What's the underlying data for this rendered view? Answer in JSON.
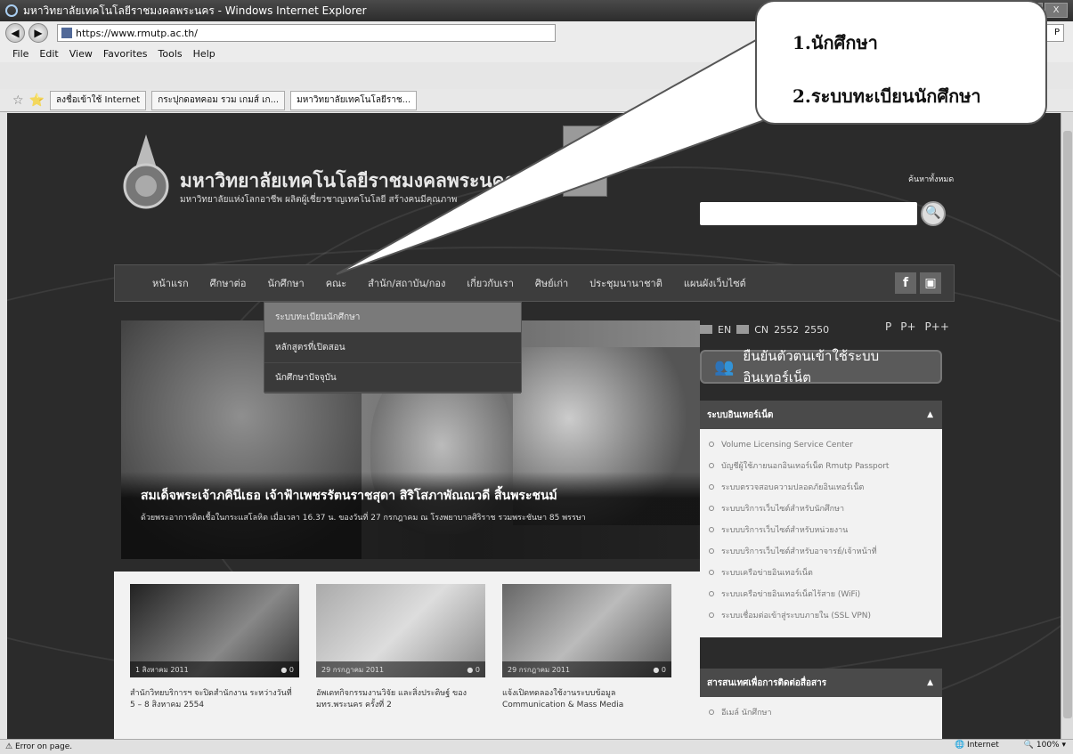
{
  "window": {
    "title": "มหาวิทยาลัยเทคโนโลยีราชมงคลพระนคร - Windows Internet Explorer",
    "buttons": [
      "_",
      "□",
      "X"
    ]
  },
  "address": {
    "back": "◀",
    "forward": "▶",
    "url": "https://www.rmutp.ac.th/",
    "search_placeholder": "P"
  },
  "menu": [
    "File",
    "Edit",
    "View",
    "Favorites",
    "Tools",
    "Help"
  ],
  "tabs": [
    {
      "label": "ลงชื่อเข้าใช้ Internet"
    },
    {
      "label": "กระปุกดอทคอม รวม เกมส์ เก..."
    },
    {
      "label": "มหาวิทยาลัยเทคโนโลยีราช..."
    }
  ],
  "callout": {
    "line1": "1.นักศึกษา",
    "line2": "2.ระบบทะเบียนนักศึกษา"
  },
  "site": {
    "name": "มหาวิทยาลัยเทคโนโลยีราชมงคลพระนคร",
    "slogan": "มหาวิทยาลัยแห่งโลกอาชีพ ผลิตผู้เชี่ยวชาญเทคโนโลยี สร้างคนมีคุณภาพ",
    "badge": "6",
    "search_all": "ค้นหาทั้งหมด",
    "search_btn": "🔍"
  },
  "nav": [
    "หน้าแรก",
    "ศึกษาต่อ",
    "นักศึกษา",
    "คณะ",
    "สำนัก/สถาบัน/กอง",
    "เกี่ยวกับเรา",
    "ศิษย์เก่า",
    "ประชุมนานาชาติ",
    "แผนผังเว็บไซต์"
  ],
  "social": [
    "f",
    "▣"
  ],
  "dropdown": [
    "ระบบทะเบียนนักศึกษา",
    "หลักสูตรที่เปิดสอน",
    "นักศึกษาปัจจุบัน"
  ],
  "hero": {
    "title": "สมเด็จพระเจ้าภคินีเธอ เจ้าฟ้าเพชรรัตนราชสุดา สิริโสภาพัณณวดี สิ้นพระชนม์",
    "text": "ด้วยพระอาการติดเชื้อในกระแสโลหิต เมื่อเวลา 16.37 น. ของวันที่ 27 กรกฎาคม ณ โรงพยาบาลศิริราช รวมพระชันษา 85 พรรษา"
  },
  "lang": {
    "en": "EN",
    "cn": "CN",
    "y1": "2552",
    "y2": "2550",
    "sizes": [
      "P",
      "P+",
      "P++"
    ]
  },
  "login": {
    "icon": "👥",
    "label": "ยืนยันตัวตนเข้าใช้ระบบอินเทอร์เน็ต"
  },
  "panel1": {
    "title": "ระบบอินเทอร์เน็ต",
    "arrow": "▲",
    "items": [
      "Volume Licensing Service Center",
      "บัญชีผู้ใช้ภายนอกอินเทอร์เน็ต Rmutp Passport",
      "ระบบตรวจสอบความปลอดภัยอินเทอร์เน็ต",
      "ระบบบริการเว็บไซต์สำหรับนักศึกษา",
      "ระบบบริการเว็บไซต์สำหรับหน่วยงาน",
      "ระบบบริการเว็บไซต์สำหรับอาจารย์/เจ้าหน้าที่",
      "ระบบเครือข่ายอินเทอร์เน็ต",
      "ระบบเครือข่ายอินเทอร์เน็ตไร้สาย (WiFi)",
      "ระบบเชื่อมต่อเข้าสู่ระบบภายใน (SSL VPN)"
    ]
  },
  "panel2": {
    "title": "สารสนเทศเพื่อการติดต่อสื่อสาร",
    "arrow": "▲",
    "items": [
      "อีเมล์ นักศึกษา"
    ]
  },
  "news": [
    {
      "date": "1 สิงหาคม 2011",
      "count": "0",
      "caption": "สำนักวิทยบริการฯ จะปิดสำนักงาน ระหว่างวันที่ 5 – 8 สิงหาคม 2554"
    },
    {
      "date": "29 กรกฎาคม 2011",
      "count": "0",
      "caption": "อัพเดทกิจกรรมงานวิจัย และสิ่งประดิษฐ์ ของ มทร.พระนคร ครั้งที่ 2"
    },
    {
      "date": "29 กรกฎาคม 2011",
      "count": "0",
      "caption": "แจ้งเปิดทดลองใช้งานระบบข้อมูล Communication & Mass Media"
    }
  ],
  "status": {
    "text": "Error on page.",
    "zone": "Internet",
    "zoom": "100%"
  }
}
